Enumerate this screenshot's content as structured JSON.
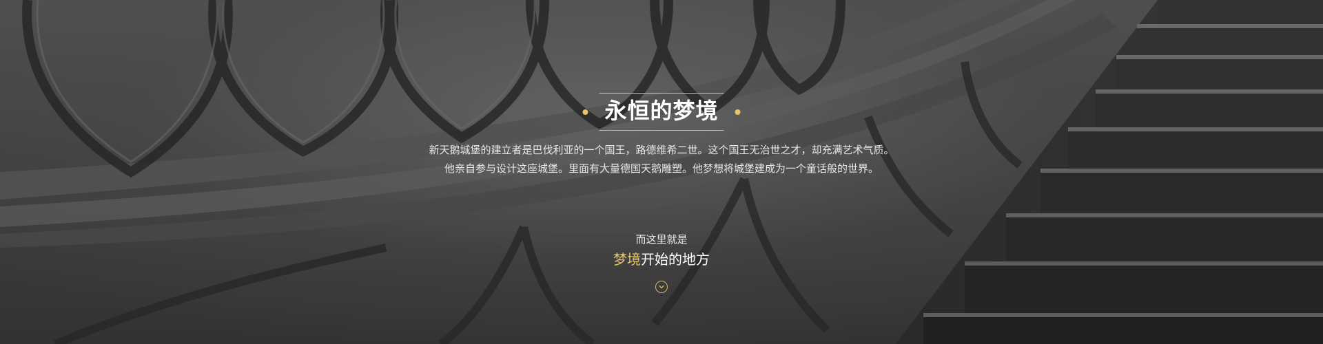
{
  "hero": {
    "title": "永恒的梦境",
    "description": "新天鹅城堡的建立者是巴伐利亚的一个国王，路德维希二世。这个国王无治世之才，却充满艺术气质。他亲自参与设计这座城堡。里面有大量德国天鹅雕塑。他梦想将城堡建成为一个童话般的世界。",
    "tagline_small": "而这里就是",
    "tagline_highlight": "梦境",
    "tagline_rest": "开始的地方",
    "scroll_icon": "chevron-down-circle-icon",
    "decor_icon": "dot-icon"
  },
  "colors": {
    "accent_gold": "#e8c46a",
    "text_light": "#f2f2f2",
    "background_gray": "#4a4a4a"
  }
}
